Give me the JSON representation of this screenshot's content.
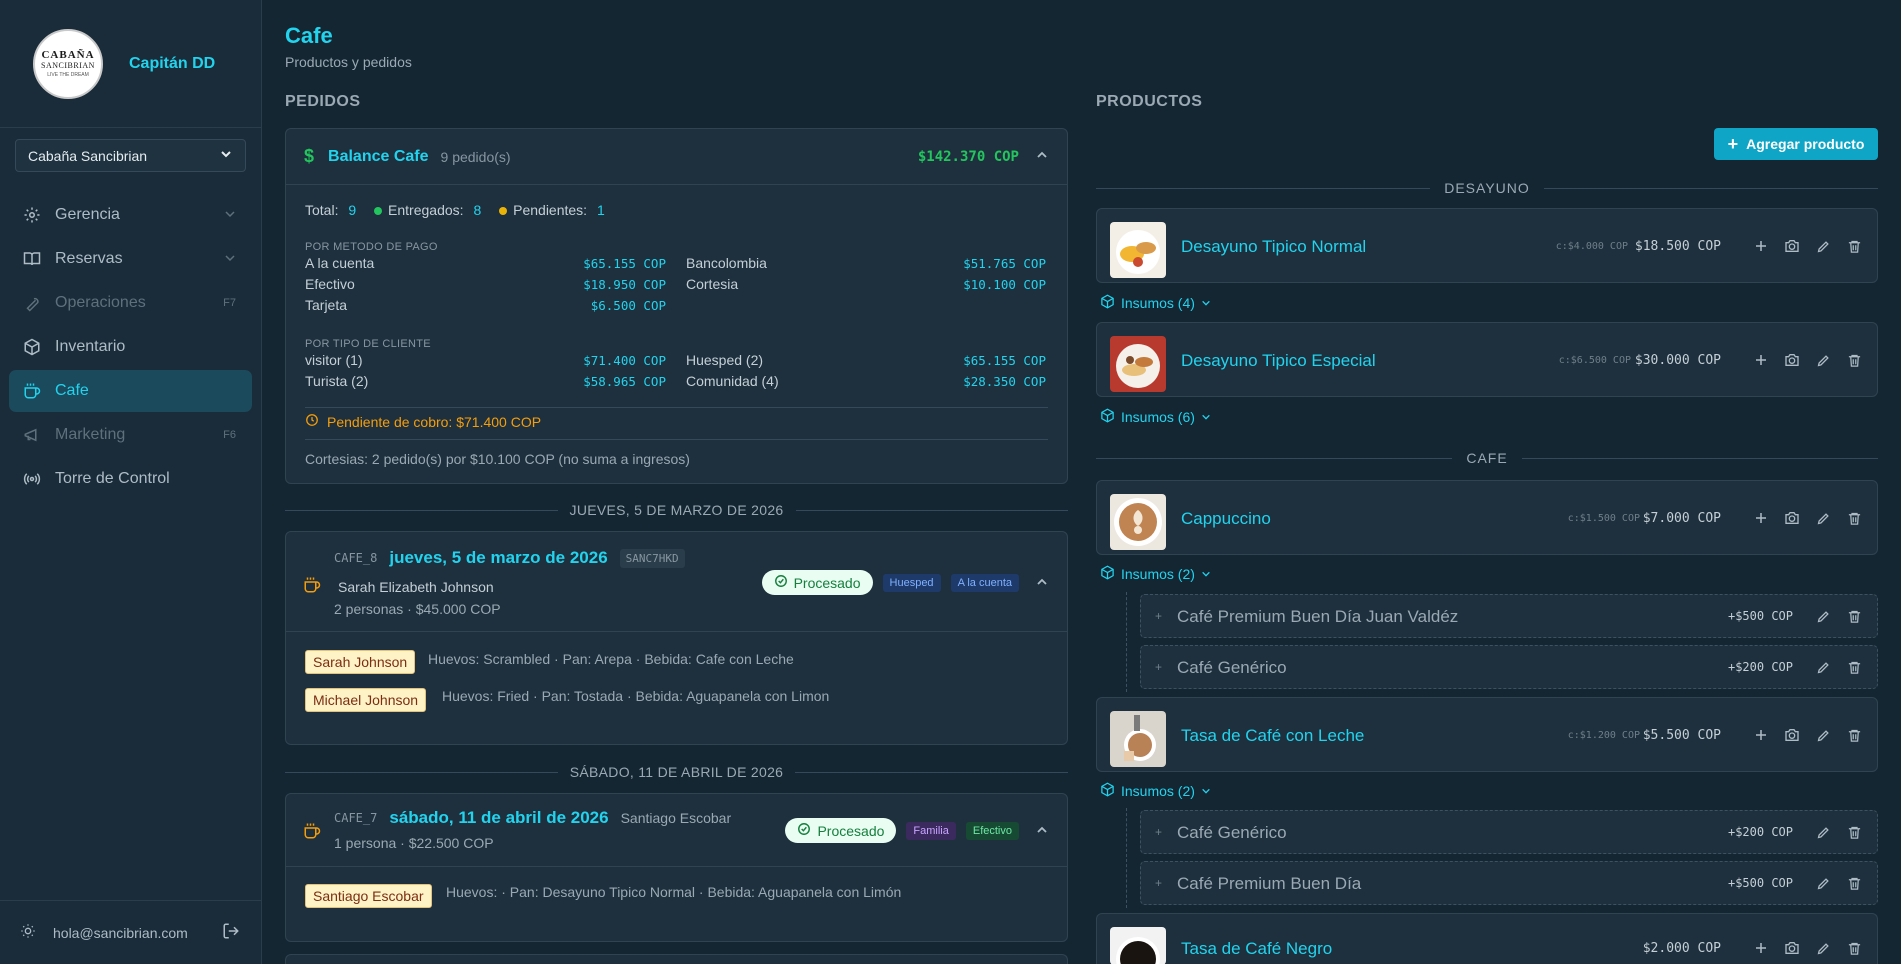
{
  "sidebar": {
    "brand_name": "Capitán DD",
    "logo": {
      "line1": "CABAÑA",
      "line2": "SANCIBRIAN",
      "line3": "LIVE THE DREAM"
    },
    "property": "Cabaña Sancibrian",
    "items": [
      {
        "label": "Gerencia",
        "icon": "gear-icon"
      },
      {
        "label": "Reservas",
        "icon": "book-icon"
      },
      {
        "label": "Operaciones",
        "icon": "wrench-icon",
        "shortcut": "F7"
      },
      {
        "label": "Inventario",
        "icon": "box-icon"
      },
      {
        "label": "Cafe",
        "icon": "coffee-icon"
      },
      {
        "label": "Marketing",
        "icon": "megaphone-icon",
        "shortcut": "F6"
      },
      {
        "label": "Torre de Control",
        "icon": "radio-tower-icon"
      }
    ],
    "email": "hola@sancibrian.com"
  },
  "header": {
    "title": "Cafe",
    "subtitle": "Productos y pedidos"
  },
  "orders": {
    "section": "PEDIDOS",
    "balance": {
      "title": "Balance Cafe",
      "count": "9 pedido(s)",
      "total": "$142.370 COP",
      "total_label": "Total:",
      "total_value": "9",
      "delivered_label": "Entregados:",
      "delivered_value": "8",
      "pending_label": "Pendientes:",
      "pending_value": "1",
      "by_payment_title": "POR METODO DE PAGO",
      "by_payment": [
        {
          "label": "A la cuenta",
          "value": "$65.155 COP"
        },
        {
          "label": "Bancolombia",
          "value": "$51.765 COP"
        },
        {
          "label": "Efectivo",
          "value": "$18.950 COP"
        },
        {
          "label": "Cortesia",
          "value": "$10.100 COP"
        },
        {
          "label": "Tarjeta",
          "value": "$6.500 COP"
        }
      ],
      "by_client_title": "POR TIPO DE CLIENTE",
      "by_client": [
        {
          "label": "visitor (1)",
          "value": "$71.400 COP"
        },
        {
          "label": "Huesped (2)",
          "value": "$65.155 COP"
        },
        {
          "label": "Turista (2)",
          "value": "$58.965 COP"
        },
        {
          "label": "Comunidad (4)",
          "value": "$28.350 COP"
        }
      ],
      "pending_charge": "Pendiente de cobro: $71.400 COP",
      "courtesy_note": "Cortesias: 2 pedido(s) por $10.100 COP (no suma a ingresos)"
    },
    "groups": [
      {
        "date_header": "JUEVES, 5 DE MARZO DE 2026",
        "code": "CAFE_8",
        "date": "jueves, 5 de marzo de 2026",
        "ref": "SANC7HKD",
        "guest": "Sarah Elizabeth Johnson",
        "summary": "2 personas · $45.000 COP",
        "status": "Procesado",
        "client_type": "Huesped",
        "payment": "A la cuenta",
        "people": [
          {
            "name": "Sarah Johnson",
            "detail": "Huevos: Scrambled · Pan: Arepa · Bebida: Cafe con Leche"
          },
          {
            "name": "Michael Johnson",
            "detail": "Huevos: Fried · Pan: Tostada · Bebida: Aguapanela con Limon"
          }
        ]
      },
      {
        "date_header": "SÁBADO, 11 DE ABRIL DE 2026",
        "code": "CAFE_7",
        "date": "sábado, 11 de abril de 2026",
        "guest": "Santiago Escobar",
        "summary": "1 persona · $22.500 COP",
        "status": "Procesado",
        "client_type": "Familia",
        "payment": "Efectivo",
        "people": [
          {
            "name": "Santiago Escobar",
            "detail": "Huevos: · Pan: Desayuno Tipico Normal · Bebida: Aguapanela con Limón"
          }
        ]
      }
    ]
  },
  "products": {
    "section": "PRODUCTOS",
    "add_label": "Agregar producto",
    "categories": [
      {
        "name": "DESAYUNO"
      },
      {
        "name": "CAFE"
      }
    ],
    "items": [
      {
        "name": "Desayuno Tipico Normal",
        "cost": "c:$4.000 COP",
        "price": "$18.500 COP",
        "insumos": "Insumos (4)"
      },
      {
        "name": "Desayuno Tipico Especial",
        "cost": "c:$6.500 COP",
        "price": "$30.000 COP",
        "insumos": "Insumos (6)"
      },
      {
        "name": "Cappuccino",
        "cost": "c:$1.500 COP",
        "price": "$7.000 COP",
        "insumos": "Insumos (2)",
        "subs": [
          {
            "name": "Café Premium Buen Día Juan Valdéz",
            "price": "+$500 COP"
          },
          {
            "name": "Café Genérico",
            "price": "+$200 COP"
          }
        ]
      },
      {
        "name": "Tasa de Café con Leche",
        "cost": "c:$1.200 COP",
        "price": "$5.500 COP",
        "insumos": "Insumos (2)",
        "subs": [
          {
            "name": "Café Genérico",
            "price": "+$200 COP"
          },
          {
            "name": "Café Premium Buen Día",
            "price": "+$500 COP"
          }
        ]
      },
      {
        "name": "Tasa de Café Negro",
        "price": "$2.000 COP"
      }
    ]
  },
  "colors": {
    "accent": "#22d3ee",
    "success": "#22c55e",
    "warning": "#f59e0b",
    "background": "#152633"
  }
}
